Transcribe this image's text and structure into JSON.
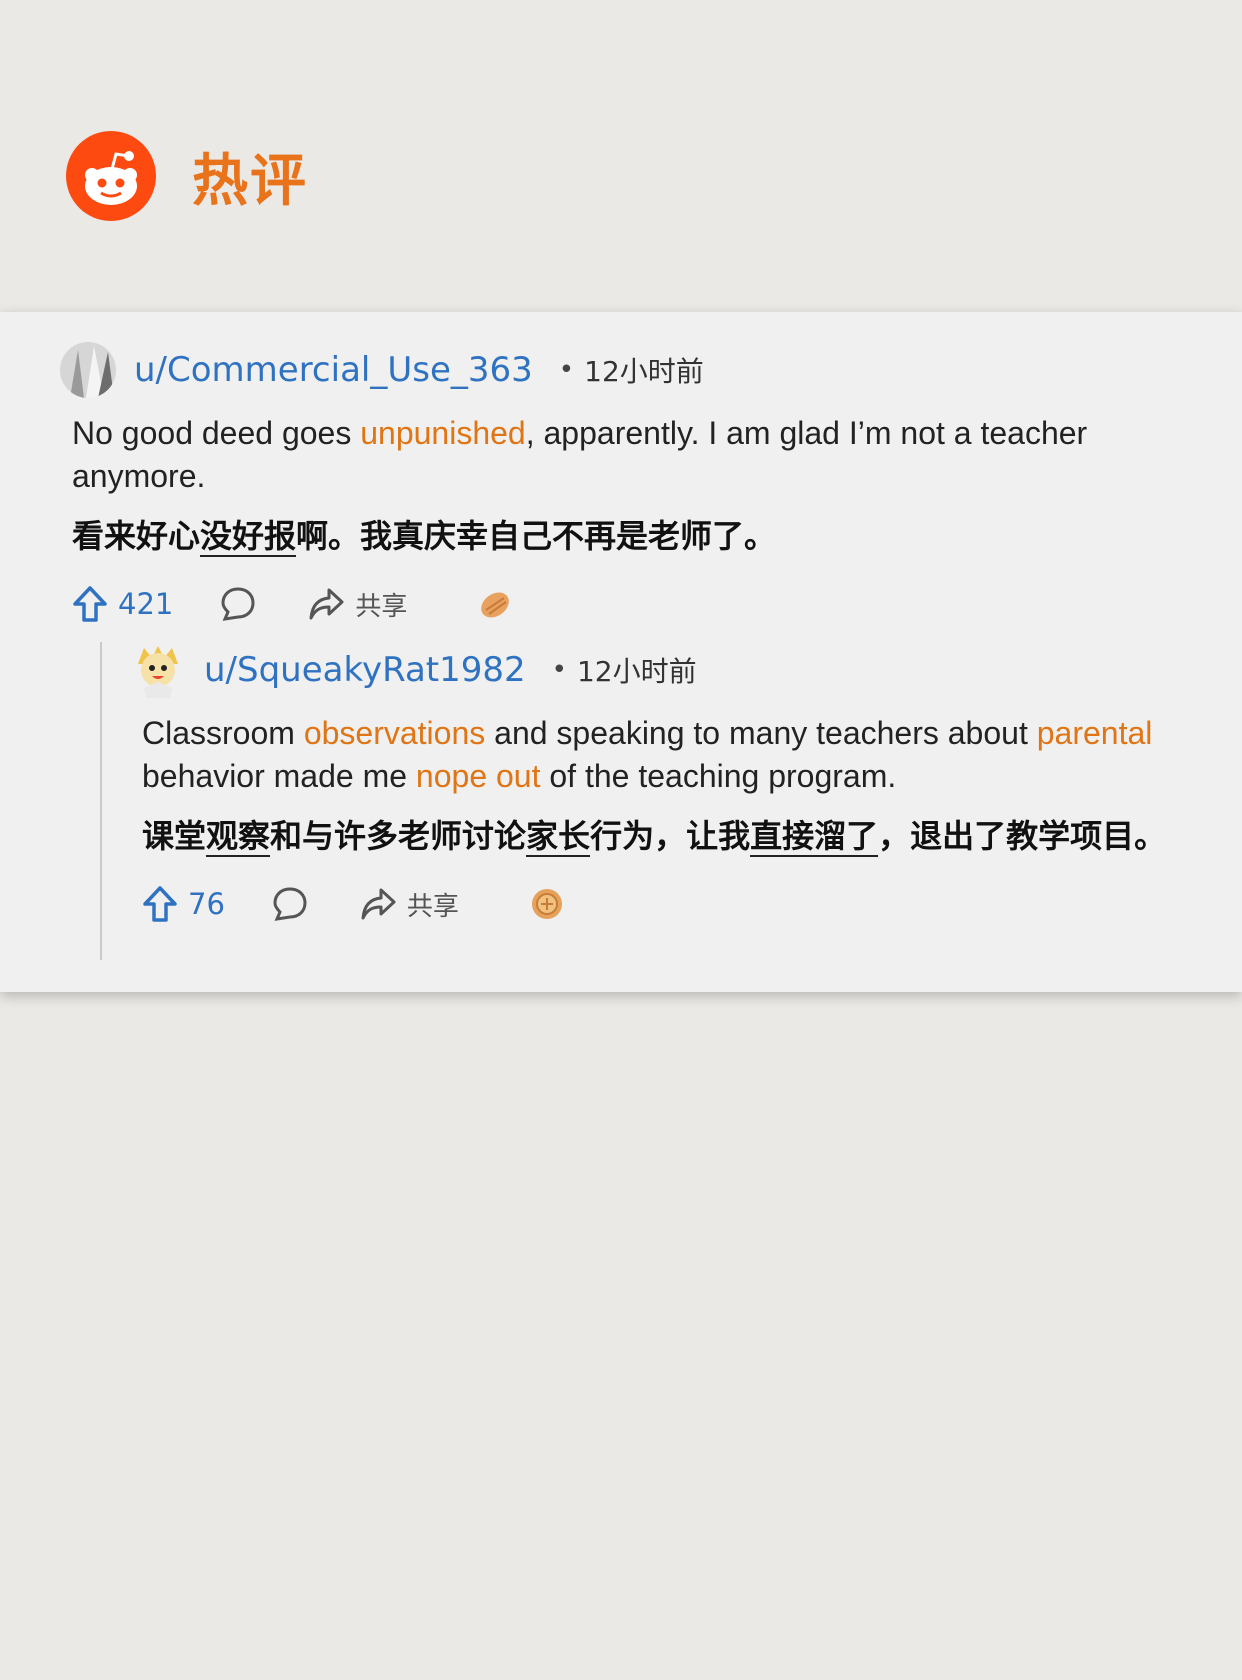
{
  "header": {
    "title": "热评"
  },
  "comments": [
    {
      "username": "u/Commercial_Use_363",
      "separator": "•",
      "time": "12小时前",
      "en": [
        "No good deed goes ",
        "unpunished",
        ", apparently. I am glad I’m not a teacher anymore."
      ],
      "zh": [
        "看来好心",
        "没好报",
        "啊。我真庆幸自己不再是老师了。"
      ],
      "upvotes": "421",
      "share_label": "共享"
    },
    {
      "username": "u/SqueakyRat1982",
      "separator": "•",
      "time": "12小时前",
      "en": [
        "Classroom ",
        "observations",
        " and speaking to many teachers about ",
        "parental",
        " behavior made me ",
        "nope out",
        " of the teaching program."
      ],
      "zh": [
        "课堂",
        "观察",
        "和与许多老师讨论",
        "家长",
        "行为，让我",
        "直接溜了",
        "，退出了教学项目。"
      ],
      "upvotes": "76",
      "share_label": "共享"
    }
  ],
  "colors": {
    "accent_orange": "#e07516",
    "reddit_orange": "#fc4a11",
    "link_blue": "#2f72c2"
  },
  "icons": [
    "reddit-logo",
    "upvote-icon",
    "comment-icon",
    "share-icon",
    "award-icon"
  ]
}
